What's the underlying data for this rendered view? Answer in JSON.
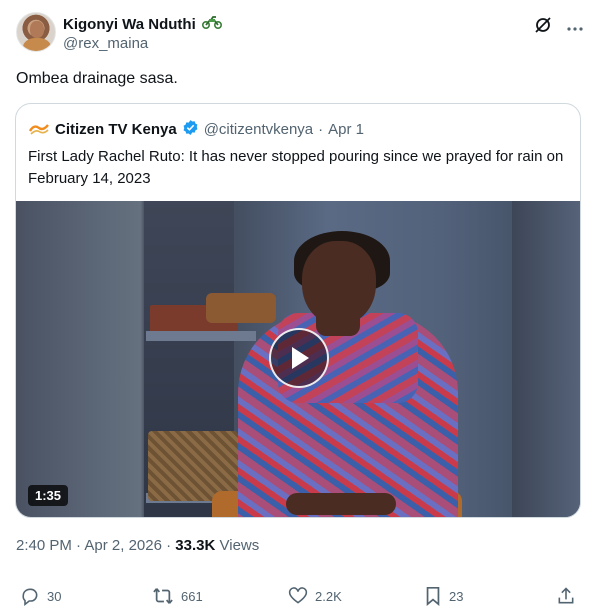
{
  "author": {
    "display_name": "Kigonyi Wa Nduthi",
    "handle": "@rex_maina",
    "emoji": "🏍️"
  },
  "tweet": {
    "text": "Ombea drainage sasa."
  },
  "quoted": {
    "name": "Citizen TV Kenya",
    "verified": true,
    "handle": "@citizentvkenya",
    "separator": "·",
    "date": "Apr 1",
    "text": "First Lady Rachel Ruto: It has never stopped pouring since we prayed for rain on February 14, 2023",
    "video_duration": "1:35"
  },
  "meta": {
    "time": "2:40 PM",
    "separator": "·",
    "date": "Apr 2, 2026",
    "views_count": "33.3K",
    "views_label": "Views"
  },
  "actions": {
    "replies": "30",
    "reposts": "661",
    "likes": "2.2K",
    "bookmarks": "23"
  },
  "colors": {
    "text": "#0f1419",
    "secondary": "#536471",
    "border": "#cfd9de",
    "verified": "#1d9bf0"
  }
}
